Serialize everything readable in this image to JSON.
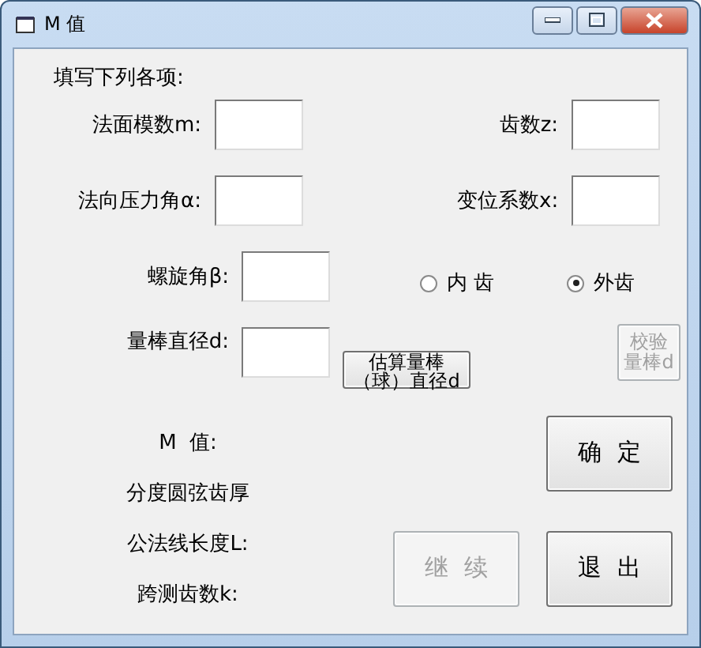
{
  "window": {
    "title": "M 值"
  },
  "heading": "填写下列各项:",
  "fields": [
    {
      "label": "法面模数m:"
    },
    {
      "label": "齿数z:"
    },
    {
      "label": "法向压力角α:"
    },
    {
      "label": "变位系数x:"
    },
    {
      "label": "螺旋角β:"
    },
    {
      "label": "量棒直径d:"
    }
  ],
  "gear_type": [
    {
      "label": "内 齿",
      "selected": false
    },
    {
      "label": "外齿",
      "selected": true
    }
  ],
  "estimate_button": {
    "label": "估算量棒（球）直径d",
    "disabled": false
  },
  "check_button": {
    "label": "校验量棒d",
    "disabled": true
  },
  "results": [
    "M  值:",
    "分度圆弦齿厚",
    "公法线长度L:",
    "跨测齿数k:"
  ],
  "buttons": [
    {
      "label": "确  定",
      "disabled": false
    },
    {
      "label": "继  续",
      "disabled": true
    },
    {
      "label": "退  出",
      "disabled": false
    }
  ]
}
